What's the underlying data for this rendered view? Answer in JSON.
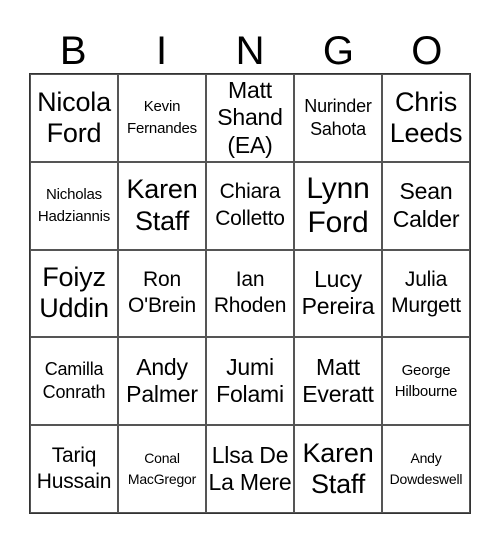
{
  "title_letters": [
    "B",
    "I",
    "N",
    "G",
    "O"
  ],
  "cells": [
    {
      "text": "Nicola Ford",
      "size": "s-l"
    },
    {
      "text": "Kevin Fernandes",
      "size": "s-xs"
    },
    {
      "text": "Matt Shand (EA)",
      "size": "s-m"
    },
    {
      "text": "Nurinder Sahota",
      "size": "s-s"
    },
    {
      "text": "Chris Leeds",
      "size": "s-l"
    },
    {
      "text": "Nicholas Hadziannis",
      "size": "s-xs"
    },
    {
      "text": "Karen Staff",
      "size": "s-l"
    },
    {
      "text": "Chiara Colletto",
      "size": "s-ms"
    },
    {
      "text": "Lynn Ford",
      "size": "s-xl"
    },
    {
      "text": "Sean Calder",
      "size": "s-m"
    },
    {
      "text": "Foiyz Uddin",
      "size": "s-l"
    },
    {
      "text": "Ron O'Brein",
      "size": "s-ms"
    },
    {
      "text": "Ian Rhoden",
      "size": "s-ms"
    },
    {
      "text": "Lucy Pereira",
      "size": "s-m"
    },
    {
      "text": "Julia Murgett",
      "size": "s-ms"
    },
    {
      "text": "Camilla Conrath",
      "size": "s-s"
    },
    {
      "text": "Andy Palmer",
      "size": "s-m"
    },
    {
      "text": "Jumi Folami",
      "size": "s-m"
    },
    {
      "text": "Matt Everatt",
      "size": "s-m"
    },
    {
      "text": "George Hilbourne",
      "size": "s-xs"
    },
    {
      "text": "Tariq Hussain",
      "size": "s-ms"
    },
    {
      "text": "Conal MacGregor",
      "size": "s-xxs"
    },
    {
      "text": "Llsa De La Mere",
      "size": "s-m"
    },
    {
      "text": "Karen Staff",
      "size": "s-l"
    },
    {
      "text": "Andy Dowdeswell",
      "size": "s-xxs"
    }
  ]
}
